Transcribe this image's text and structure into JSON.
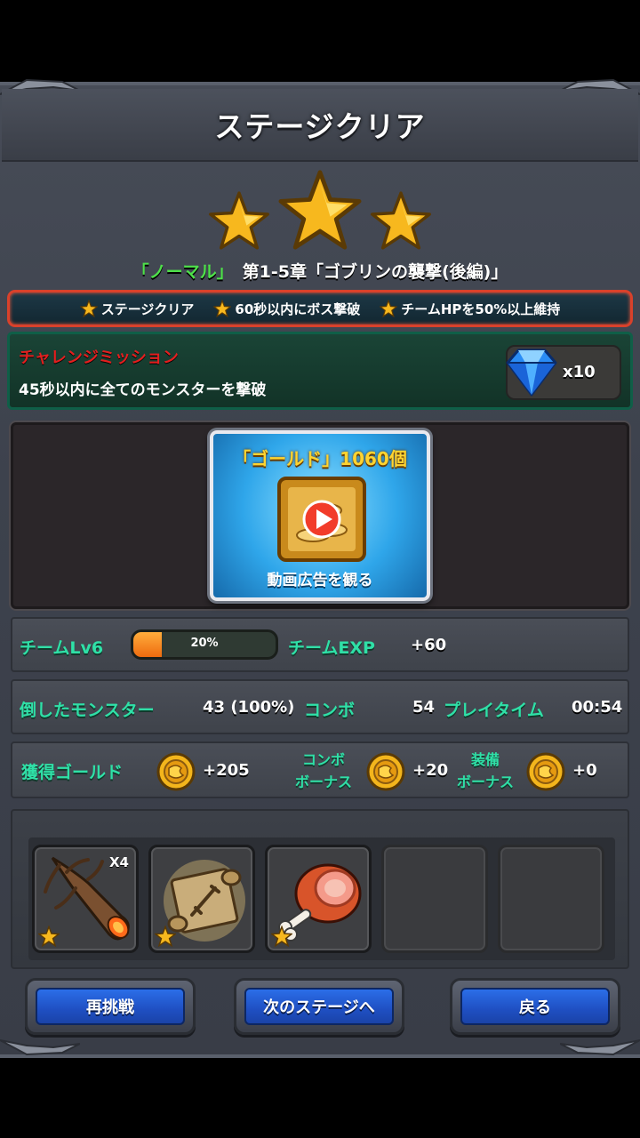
{
  "header": {
    "title": "ステージクリア"
  },
  "stars": {
    "earned": 3,
    "total": 3
  },
  "stage": {
    "difficulty": "「ノーマル」",
    "chapter": "第1-5章「ゴブリンの襲撃(後編)」"
  },
  "conditions": [
    {
      "label": "ステージクリア"
    },
    {
      "label": "60秒以内にボス撃破"
    },
    {
      "label": "チームHPを50%以上維持"
    }
  ],
  "mission": {
    "title": "チャレンジミッション",
    "description": "45秒以内に全てのモンスターを撃破",
    "reward_icon": "diamond-icon",
    "reward_qty": "x10"
  },
  "ad": {
    "title": "「ゴールド」1060個",
    "subtitle": "動画広告を観る",
    "icon": "video-play-icon"
  },
  "team": {
    "level_label": "チームLv6",
    "exp_percent_text": "20%",
    "exp_fraction": 0.2,
    "exp_label": "チームEXP",
    "exp_value": "+60"
  },
  "battle": {
    "monsters_label": "倒したモンスター",
    "monsters_value": "43 (100%)",
    "combo_label": "コンボ",
    "combo_value": "54",
    "playtime_label": "プレイタイム",
    "playtime_value": "00:54"
  },
  "gold": {
    "label": "獲得ゴールド",
    "value": "+205",
    "combo_bonus_label_1": "コンボ",
    "combo_bonus_label_2": "ボーナス",
    "combo_bonus_value": "+20",
    "equip_bonus_label_1": "装備",
    "equip_bonus_label_2": "ボーナス",
    "equip_bonus_value": "+0"
  },
  "items": [
    {
      "name": "branch-item-icon",
      "count": "X4",
      "rarity": 1
    },
    {
      "name": "scroll-item-icon",
      "count": "",
      "rarity": 1
    },
    {
      "name": "meat-item-icon",
      "count": "",
      "rarity": 1
    },
    {
      "name": "empty-slot",
      "count": "",
      "rarity": 0
    },
    {
      "name": "empty-slot",
      "count": "",
      "rarity": 0
    }
  ],
  "buttons": {
    "retry": "再挑戦",
    "next": "次のステージへ",
    "back": "戻る"
  },
  "colors": {
    "accent_green": "#2fe0a7",
    "mission_red": "#e21f1f",
    "button_blue": "#2b6ee8",
    "exp_orange": "#ee6b0f",
    "ad_gold": "#ffd431"
  }
}
